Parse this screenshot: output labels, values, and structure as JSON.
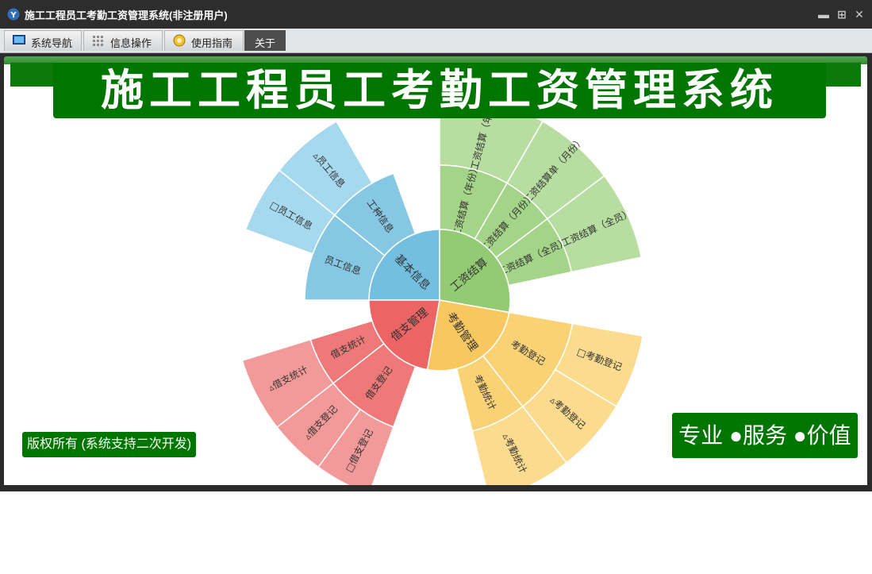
{
  "window": {
    "title": "施工工程员工考勤工资管理系统(非注册用户)"
  },
  "menu": {
    "tabs": [
      {
        "label": "系统导航",
        "icon": "monitor-icon"
      },
      {
        "label": "信息操作",
        "icon": "grid-icon"
      },
      {
        "label": "使用指南",
        "icon": "guide-icon"
      },
      {
        "label": "关于",
        "icon": ""
      }
    ],
    "active": "关于"
  },
  "banner": {
    "title": "施工工程员工考勤工资管理系统"
  },
  "footer": {
    "copyright": "版权所有 (系统支持二次开发)",
    "slogan": "专业 ●服务 ●价值"
  },
  "sunburst": {
    "inner": [
      {
        "label": "基本信息",
        "color": "#74bfe0"
      },
      {
        "label": "工资结算",
        "color": "#92cb73"
      },
      {
        "label": "考勤管理",
        "color": "#f8c860"
      },
      {
        "label": "借支管理",
        "color": "#ec6464"
      }
    ],
    "middle": [
      {
        "label": "员工信息",
        "parent": "基本信息"
      },
      {
        "label": "工种信息",
        "parent": "基本信息"
      },
      {
        "label": "工资结算（年份）",
        "parent": "工资结算"
      },
      {
        "label": "工资结算（月份）",
        "parent": "工资结算"
      },
      {
        "label": "工资结算（全员）",
        "parent": "工资结算"
      },
      {
        "label": "考勤登记",
        "parent": "考勤管理"
      },
      {
        "label": "考勤统计",
        "parent": "考勤管理"
      },
      {
        "label": "借支登记",
        "parent": "借支管理"
      },
      {
        "label": "借支统计",
        "parent": "借支管理"
      }
    ],
    "outer": [
      {
        "label": "□员工信息",
        "parent": "员工信息"
      },
      {
        "label": "▵员工信息",
        "parent": "员工信息"
      },
      {
        "label": "▵工资结算（年份）",
        "parent": "工资结算（年份）"
      },
      {
        "label": "▵工资结算单（月份）",
        "parent": "工资结算（月份）"
      },
      {
        "label": "▵工资结算（全员）",
        "parent": "工资结算（全员）"
      },
      {
        "label": "□考勤登记",
        "parent": "考勤登记"
      },
      {
        "label": "▵考勤登记",
        "parent": "考勤登记"
      },
      {
        "label": "▵考勤统计",
        "parent": "考勤统计"
      },
      {
        "label": "□借支登记",
        "parent": "借支登记"
      },
      {
        "label": "▵借支登记",
        "parent": "借支登记"
      },
      {
        "label": "▵借支统计",
        "parent": "借支统计"
      }
    ]
  }
}
